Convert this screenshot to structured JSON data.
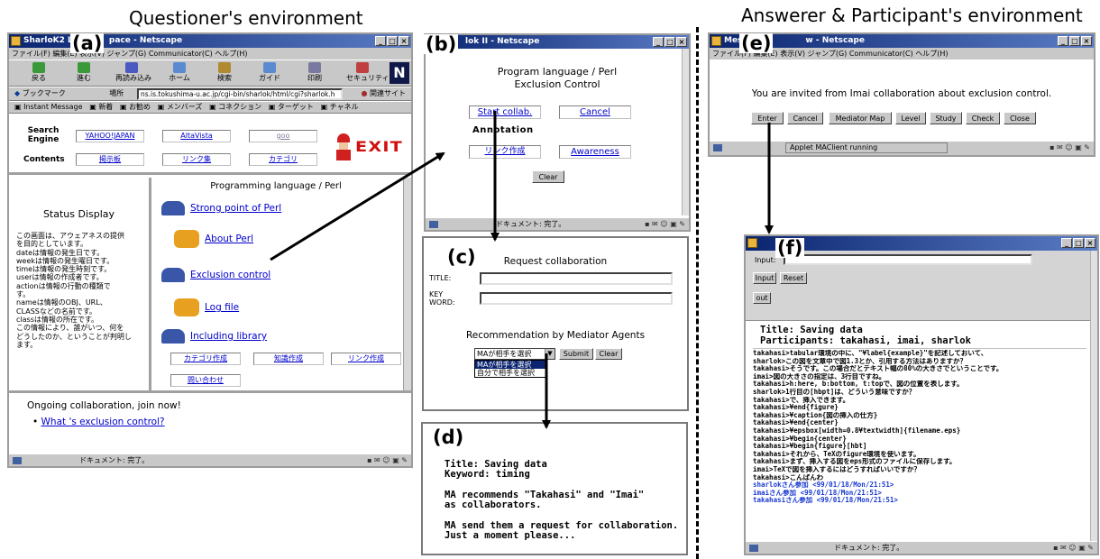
{
  "headings": {
    "questioner": "Questioner's environment",
    "answerer": "Answerer & Participant's environment"
  },
  "colors": {
    "accent_red": "#c81010",
    "link_blue": "#0000cc",
    "titlebar": "#0a2470"
  },
  "win_a": {
    "label": "(a)",
    "title": "SharloK2 Le",
    "title_tail": "pace - Netscape",
    "menu": "ファイル(F)   編集(E)   表示(V)   ジャンプ(G)   Communicator(C)   ヘルプ(H)",
    "toolbar": [
      "戻る",
      "進む",
      "再読み込み",
      "ホーム",
      "検索",
      "ガイド",
      "印刷",
      "セキュリティ"
    ],
    "location_label": "ブックマーク",
    "location_field_label": "場所",
    "url": "ns.is.tokushima-u.ac.jp/cgi-bin/sharlok/html/cgi?sharlok.h",
    "related": "関連サイト",
    "personal_bar": [
      "Instant Message",
      "新着",
      "お勧め",
      "メンバーズ",
      "コネクション",
      "ターゲット",
      "チャネル"
    ],
    "search_label": "Search Engine",
    "contents_label": "Contents",
    "search_buttons": [
      "YAHOO!JAPAN",
      "AltaVista",
      "goo"
    ],
    "contents_buttons": [
      "掲示板",
      "リンク集",
      "カテゴリ"
    ],
    "exit_label": "EXIT",
    "status_display": "Status Display",
    "status_text": [
      "この画面は、アウェアネスの提供",
      "を目的としています。",
      "dateは情報の発生日です。",
      "weekは情報の発生曜日です。",
      "timeは情報の発生時刻です。",
      "userは情報の作成者です。",
      "actionは情報の行動の種類で",
      "す。",
      "nameは情報のOBJ、URL、",
      "CLASSなどの名前です。",
      "classは情報の所在です。",
      "この情報により、誰がいつ、何を",
      "どうしたのか、ということが判明し",
      "ます。"
    ],
    "topic_title": "Programming language / Perl",
    "topics": [
      "Strong point of Perl",
      "About Perl",
      "Exclusion control",
      "Log file",
      "Including library"
    ],
    "bottom_buttons": [
      "カテゴリ作成",
      "知識作成",
      "リンク作成"
    ],
    "ask_button": "問い合わせ",
    "ongoing": "Ongoing collaboration, join now!",
    "ongoing_link": "What 's exclusion control?",
    "statusbar": "ドキュメント: 完了。"
  },
  "win_b": {
    "label": "(b)",
    "title": "lok II - Netscape",
    "heading1": "Program language / Perl",
    "heading2": "Exclusion Control",
    "buttons": [
      "Start collab.",
      "Cancel",
      "Annotation",
      "リンク作成",
      "Awareness"
    ],
    "clear": "Clear",
    "statusbar": "ドキュメント: 完了。"
  },
  "win_c": {
    "label": "(c)",
    "heading": "Request collaboration",
    "title_label": "TITLE:",
    "key_label": "KEY",
    "word_label": "WORD:",
    "recommend": "Recommendation by Mediator Agents",
    "select_value": "MAが相手を選択",
    "options": [
      "MAが相手を選択",
      "自分で相手を選択"
    ],
    "submit": "Submit",
    "clear": "Clear"
  },
  "win_d": {
    "label": "(d)",
    "lines": [
      "Title: Saving data",
      "Keyword: timing",
      "",
      "MA recommends \"Takahasi\" and \"Imai\"",
      "as collaborators.",
      "",
      "MA send them a request for collaboration.",
      "Just a moment please..."
    ]
  },
  "win_e": {
    "label": "(e)",
    "title_head": "Message",
    "title_tail": "w - Netscape",
    "menu": "ファイル(F)   編集(E)   表示(V)   ジャンプ(G)   Communicator(C)   ヘルプ(H)",
    "invite": "You are invited from Imai collaboration about exclusion control.",
    "buttons": [
      "Enter",
      "Cancel",
      "Mediator Map",
      "Level",
      "Study",
      "Check",
      "Close"
    ],
    "statusbar": "Applet MAClient running"
  },
  "win_f": {
    "label": "(f)",
    "input_label": "Input:",
    "input_button": "Input",
    "reset_button": "Reset",
    "out_button": "out",
    "title_line": "Title: Saving data",
    "participants": "Participants: takahasi, imai, sharlok",
    "chat": [
      "takahasi>tabular環境の中に、\"¥label{example}\"を記述しておいて、",
      "sharlok>この図を文章中で図1.3とか、引用する方法はありますか？",
      "takahasi>そうです。この場合だとテキスト幅の80%の大きさでということです。",
      "imai>図の大きさの指定は、3行目ですね。",
      "takahasi>h:here, b:bottom, t:topで、図の位置を表します。",
      "sharlok>1行目の[hbpt]は、どういう意味ですか？",
      "takahasi>で、挿入できます。",
      "takahasi>¥end{figure}",
      "takahasi>¥caption{図の挿入の仕方}",
      "takahasi>¥end{center}",
      "takahasi>¥epsbox[width=0.8¥textwidth]{filename.eps}",
      "takahasi>¥begin{center}",
      "takahasi>¥begin{figure}[hbt]",
      "takahasi>それから、TeXのfigure環境を使います。",
      "takahasi>まず、挿入する図をeps形式のファイルに保存します。",
      "imai>TeXで図を挿入するにはどうすればいいですか？",
      "takahasi>こんばんわ"
    ],
    "joins": [
      "sharlokさん参加 <99/01/18/Mon/21:51>",
      "imaiさん参加 <99/01/18/Mon/21:51>",
      "takahasiさん参加 <99/01/18/Mon/21:51>"
    ],
    "statusbar": "ドキュメント: 完了。"
  }
}
